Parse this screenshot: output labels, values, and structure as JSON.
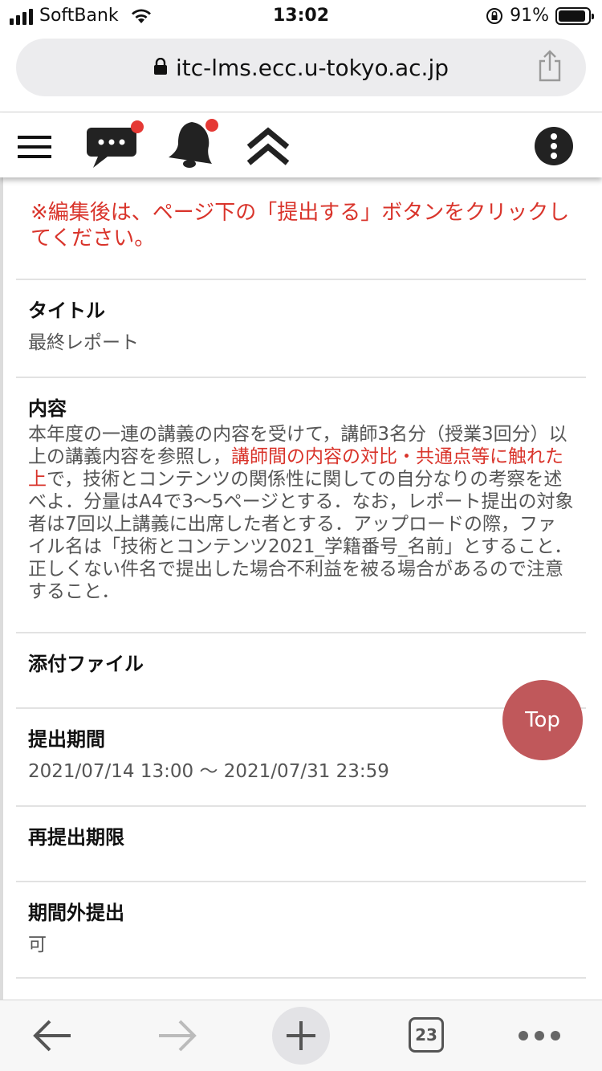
{
  "status_bar": {
    "carrier": "SoftBank",
    "time": "13:02",
    "battery_percent": "91%",
    "battery_level": 0.91
  },
  "browser": {
    "url": "itc-lms.ecc.u-tokyo.ac.jp",
    "tab_count": "23"
  },
  "toolbar": {
    "icons": [
      "menu-icon",
      "chat-icon",
      "bell-icon",
      "collapse-up-icon",
      "more-vertical-icon"
    ],
    "badge_color": "#e53935"
  },
  "notice": "※編集後は、ページ下の「提出する」ボタンをクリックしてください。",
  "fields": {
    "title_label": "タイトル",
    "title_value": "最終レポート",
    "content_label": "内容",
    "content_part1": "本年度の一連の講義の内容を受けて，講師3名分（授業3回分）以上の講義内容を参照し，",
    "content_highlight": "講師間の内容の対比・共通点等に触れた上",
    "content_part2": "で，技術とコンテンツの関係性に関しての自分なりの考察を述べよ．分量はA4で3〜5ページとする．なお，レポート提出の対象者は7回以上講義に出席した者とする．アップロードの際，ファイル名は「技術とコンテンツ2021_学籍番号_名前」とすること．正しくない件名で提出した場合不利益を被る場合があるので注意すること．",
    "attachment_label": "添付ファイル",
    "period_label": "提出期間",
    "period_value": "2021/07/14 13:00 〜 2021/07/31 23:59",
    "resubmit_label": "再提出期限",
    "late_label": "期間外提出",
    "late_value": "可"
  },
  "top_button": "Top",
  "colors": {
    "accent_red": "#d9342b",
    "top_button_bg": "#c0585b"
  }
}
